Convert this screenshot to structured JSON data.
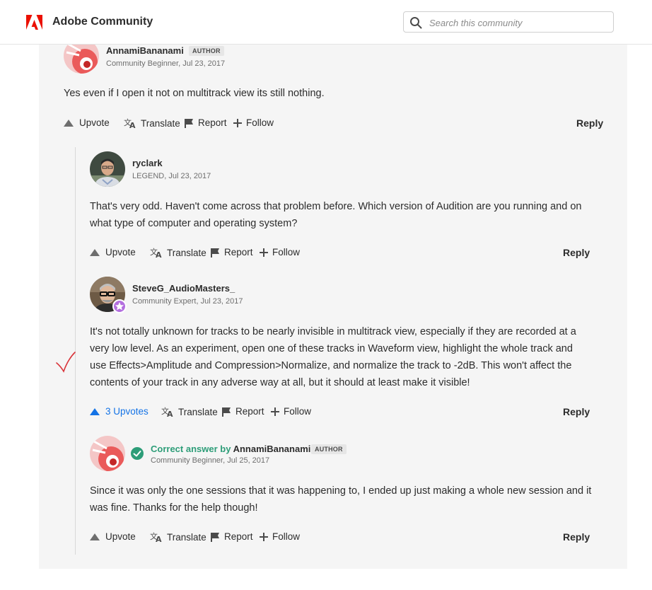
{
  "header": {
    "brand": "Adobe Community",
    "search_placeholder": "Search this community"
  },
  "actions": {
    "upvote": "Upvote",
    "translate": "Translate",
    "report": "Report",
    "follow": "Follow",
    "reply": "Reply"
  },
  "posts": [
    {
      "author": "AnnamiBananami",
      "badge": "AUTHOR",
      "meta": "Community Beginner, Jul 23, 2017",
      "body": "Yes even if I open it not on multitrack view its still nothing."
    },
    {
      "author": "ryclark",
      "meta": "LEGEND, Jul 23, 2017",
      "body": "That's very odd. Haven't come across that problem before. Which version of Audition are you running and on what type of computer and operating system?"
    },
    {
      "author": "SteveG_AudioMasters_",
      "meta": "Community Expert, Jul 23, 2017",
      "body": "It's not totally unknown for tracks to be nearly invisible in multitrack view, especially if they are recorded at a very low level. As an experiment, open one of these tracks in Waveform view, highlight the whole track and use Effects>Amplitude and Compression>Normalize, and normalize the track to -2dB. This won't affect the contents of your track in any adverse way at all, but it should at least make it visible!",
      "upvotes": "3 Upvotes"
    },
    {
      "correct_prefix": "Correct answer by",
      "author": "AnnamiBananami",
      "badge": "AUTHOR",
      "meta": "Community Beginner, Jul 25, 2017",
      "body": "Since it was only the one sessions that it was happening to, I ended up just making a whole new session and it was fine. Thanks for the help though!"
    }
  ],
  "colors": {
    "adobe_red": "#eb1000",
    "accent_blue": "#1473e6",
    "correct_green": "#2d9d78",
    "expert_purple": "#b36fdf"
  }
}
